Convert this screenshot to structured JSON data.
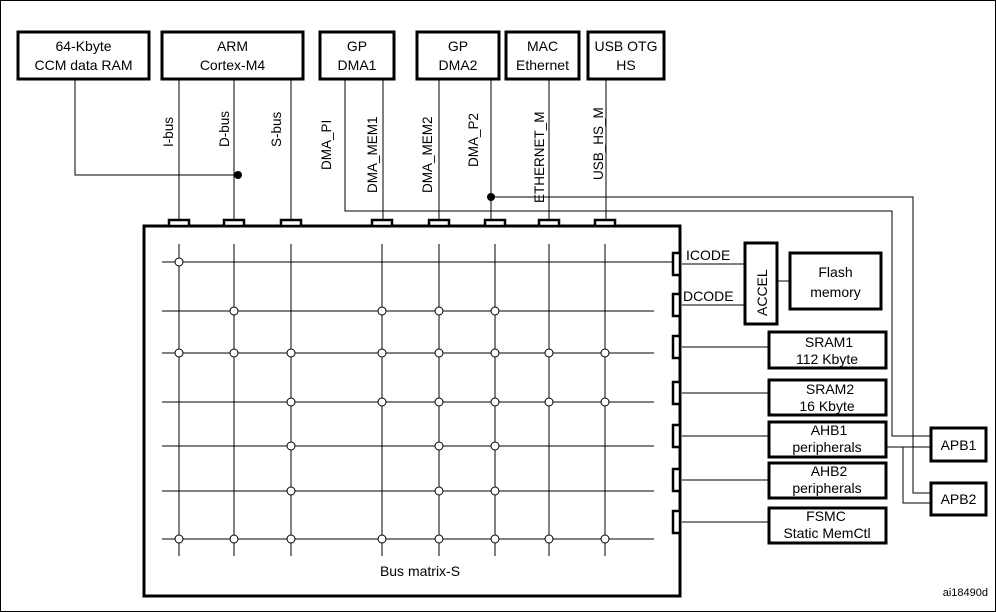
{
  "masters": {
    "ccm": [
      "64-Kbyte",
      "CCM data RAM"
    ],
    "arm": [
      "ARM",
      "Cortex-M4"
    ],
    "dma1": [
      "GP",
      "DMA1"
    ],
    "dma2": [
      "GP",
      "DMA2"
    ],
    "mac": [
      "MAC",
      "Ethernet"
    ],
    "usb": [
      "USB OTG",
      "HS"
    ]
  },
  "buses": [
    "I-bus",
    "D-bus",
    "S-bus",
    "DMA_PI",
    "DMA_MEM1",
    "DMA_MEM2",
    "DMA_P2",
    "ETHERNET_M",
    "USB_HS_M"
  ],
  "slave_ports": {
    "icode": "ICODE",
    "dcode": "DCODE"
  },
  "slaves": {
    "accel": "ACCEL",
    "flash": [
      "Flash",
      "memory"
    ],
    "sram1": [
      "SRAM1",
      "112 Kbyte"
    ],
    "sram2": [
      "SRAM2",
      "16 Kbyte"
    ],
    "ahb1": [
      "AHB1",
      "peripherals"
    ],
    "ahb2": [
      "AHB2",
      "peripherals"
    ],
    "fsmc": [
      "FSMC",
      "Static MemCtl"
    ],
    "apb1": "APB1",
    "apb2": "APB2"
  },
  "matrix": {
    "label": "Bus matrix-S",
    "connections": [
      [
        1,
        0,
        0,
        0,
        0,
        0,
        0,
        0
      ],
      [
        0,
        1,
        0,
        1,
        1,
        1,
        0,
        0
      ],
      [
        1,
        1,
        1,
        1,
        1,
        1,
        1,
        1
      ],
      [
        0,
        0,
        1,
        1,
        1,
        1,
        1,
        1
      ],
      [
        0,
        0,
        1,
        0,
        1,
        1,
        0,
        0
      ],
      [
        0,
        0,
        1,
        0,
        1,
        1,
        0,
        0
      ],
      [
        1,
        1,
        1,
        1,
        1,
        1,
        1,
        1
      ]
    ]
  },
  "figure_id": "ai18490d"
}
